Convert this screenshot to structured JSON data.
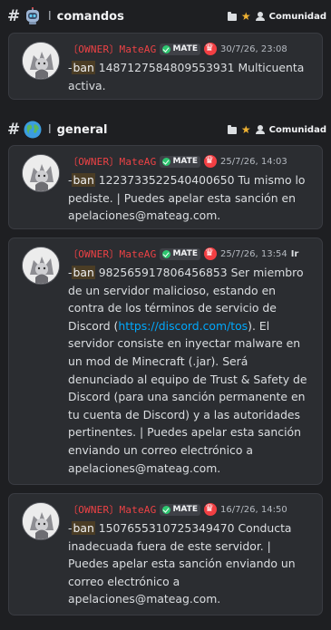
{
  "channels": [
    {
      "emoji": "robot-icon",
      "separator": "l",
      "name": "comandos",
      "community_label": "Comunidad",
      "messages": [
        {
          "author": "〔OWNER〕MateAG",
          "tag": "MATE",
          "timestamp": "30/7/26, 23:08",
          "command": "ban",
          "prefix": "-",
          "text": " 1487127584809553931 Multicuenta activa."
        }
      ]
    },
    {
      "emoji": "globe-icon",
      "separator": "l",
      "name": "general",
      "community_label": "Comunidad",
      "messages": [
        {
          "author": "〔OWNER〕MateAG",
          "tag": "MATE",
          "timestamp": "25/7/26, 14:03",
          "command": "ban",
          "prefix": "-",
          "text": " 1223733522540400650 Tu mismo lo pediste. | Puedes apelar esta sanción en apelaciones@mateag.com."
        },
        {
          "author": "〔OWNER〕MateAG",
          "tag": "MATE",
          "timestamp": "25/7/26, 13:54",
          "overflow": "Ir",
          "command": "ban",
          "prefix": "-",
          "text_before_link": " 982565917806456853 Ser miembro de un servidor malicioso, estando en contra de los términos de servicio de Discord (",
          "link": "https://discord.com/tos",
          "text_after_link": "). El servidor consiste en inyectar malware en un mod de Minecraft (.jar). Será denunciado al equipo de Trust & Safety de Discord (para una sanción permanente en tu cuenta de Discord) y a las autoridades pertinentes. | Puedes apelar esta sanción enviando un correo electrónico a apelaciones@mateag.com."
        },
        {
          "author": "〔OWNER〕MateAG",
          "tag": "MATE",
          "timestamp": "16/7/26, 14:50",
          "command": "ban",
          "prefix": "-",
          "text": " 1507655310725349470 Conducta inadecuada fuera de este servidor. | Puedes apelar esta sanción enviando un correo electrónico a apelaciones@mateag.com."
        }
      ]
    }
  ],
  "colors": {
    "author": "#ed4245",
    "link": "#00a8fc",
    "card_bg": "#2b2d31",
    "page_bg": "#1e1f22",
    "ban_highlight": "#4b3d25"
  }
}
